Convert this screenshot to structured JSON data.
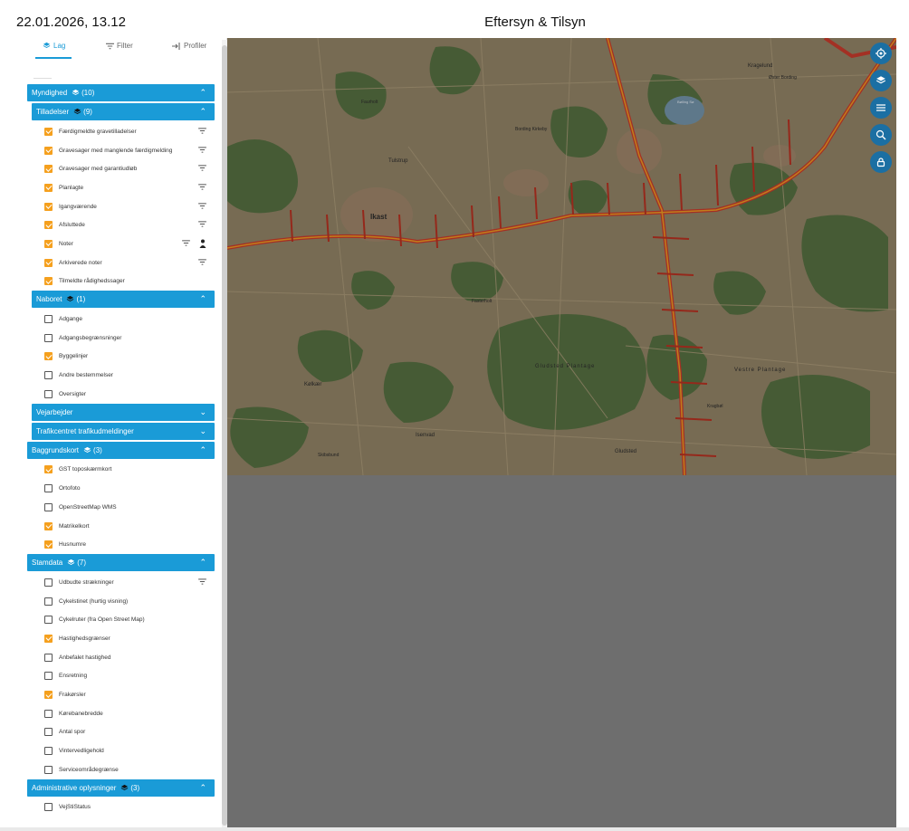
{
  "header": {
    "datetime": "22.01.2026, 13.12",
    "title": "Eftersyn & Tilsyn"
  },
  "tabs": [
    {
      "label": "Lag",
      "icon": "layers-icon",
      "active": true
    },
    {
      "label": "Filter",
      "icon": "filter-icon",
      "active": false
    },
    {
      "label": "Profiler",
      "icon": "login-icon",
      "active": false
    }
  ],
  "groups": {
    "myndighed": {
      "label": "Myndighed",
      "count": "(10)"
    },
    "tilladelser": {
      "label": "Tilladelser",
      "count": "(9)",
      "items": [
        {
          "label": "Færdigmeldte gravetilladelser",
          "checked": true,
          "filter": true
        },
        {
          "label": "Gravesager med manglende færdigmelding",
          "checked": true,
          "filter": true
        },
        {
          "label": "Gravesager med garantiudløb",
          "checked": true,
          "filter": true
        },
        {
          "label": "Planlagte",
          "checked": true,
          "filter": true
        },
        {
          "label": "Igangværende",
          "checked": true,
          "filter": true
        },
        {
          "label": "Afsluttede",
          "checked": true,
          "filter": true
        },
        {
          "label": "Noter",
          "checked": true,
          "filter": true,
          "person": true
        },
        {
          "label": "Arkiverede noter",
          "checked": true,
          "filter": true
        },
        {
          "label": "Tilmeldte rådighedssager",
          "checked": true,
          "filter": false
        }
      ]
    },
    "naboret": {
      "label": "Naboret",
      "count": "(1)",
      "items": [
        {
          "label": "Adgange",
          "checked": false
        },
        {
          "label": "Adgangsbegrænsninger",
          "checked": false
        },
        {
          "label": "Byggelinjer",
          "checked": true
        },
        {
          "label": "Andre bestemmelser",
          "checked": false
        },
        {
          "label": "Oversigter",
          "checked": false
        }
      ]
    },
    "vejarbejder": {
      "label": "Vejarbejder"
    },
    "trafikcentret": {
      "label": "Trafikcentret trafikudmeldinger"
    },
    "baggrundskort": {
      "label": "Baggrundskort",
      "count": "(3)",
      "items": [
        {
          "label": "GST toposkærmkort",
          "checked": true
        },
        {
          "label": "Ortofoto",
          "checked": false
        },
        {
          "label": "OpenStreetMap WMS",
          "checked": false
        },
        {
          "label": "Matrikelkort",
          "checked": true
        },
        {
          "label": "Husnumre",
          "checked": true
        }
      ]
    },
    "stamdata": {
      "label": "Stamdata",
      "count": "(7)",
      "items": [
        {
          "label": "Udbudte strækninger",
          "checked": false,
          "filter": true
        },
        {
          "label": "Cykelstinet (hurtig visning)",
          "checked": false
        },
        {
          "label": "Cykelruter (fra Open Street Map)",
          "checked": false
        },
        {
          "label": "Hastighedsgrænser",
          "checked": true
        },
        {
          "label": "Anbefalet hastighed",
          "checked": false
        },
        {
          "label": "Ensretning",
          "checked": false
        },
        {
          "label": "Frakørsler",
          "checked": true
        },
        {
          "label": "Kørebanebredde",
          "checked": false
        },
        {
          "label": "Antal spor",
          "checked": false
        },
        {
          "label": "Vintervedligehold",
          "checked": false
        },
        {
          "label": "Serviceområdegrænse",
          "checked": false
        }
      ]
    },
    "administrative": {
      "label": "Administrative oplysninger",
      "count": "(3)",
      "items": [
        {
          "label": "VejStiStatus",
          "checked": false
        }
      ]
    }
  },
  "map": {
    "places": [
      "Ikast",
      "Tulstrup",
      "Faurholt",
      "Bording Kirkeby",
      "Kragelund",
      "Øster Bording",
      "Kølkær",
      "Isenvad",
      "Bølling Sø",
      "Skibsbund",
      "Gludsted",
      "Gludsted Plantage",
      "Vestre Plantage",
      "Kragbøl",
      "Fasterholt"
    ],
    "fab_icons": [
      "locate-icon",
      "layers-icon",
      "list-icon",
      "search-zoom-icon",
      "lock-icon"
    ]
  }
}
